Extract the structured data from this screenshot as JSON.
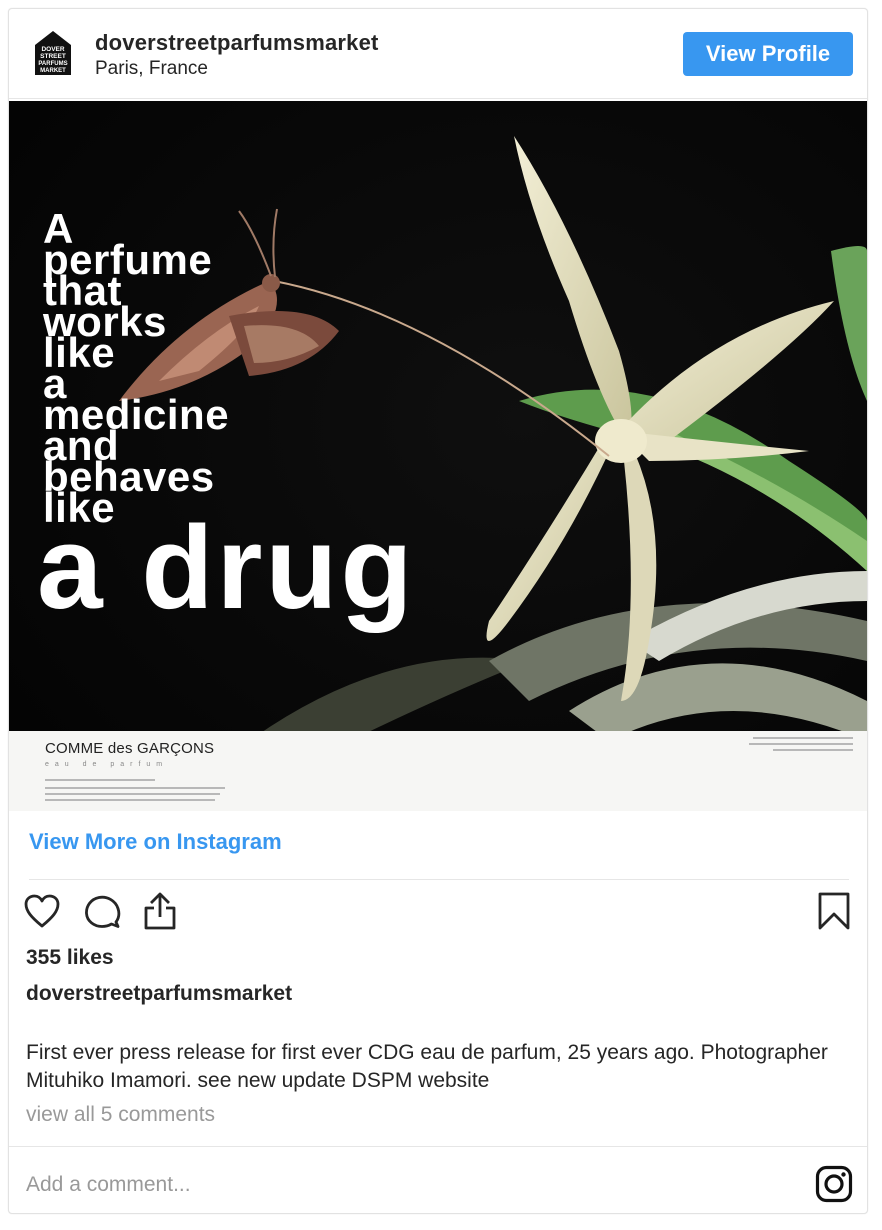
{
  "post": {
    "username": "doverstreetparfumsmarket",
    "location": "Paris, France",
    "view_profile_label": "View Profile",
    "avatar_lines": [
      "DOVER",
      "STREET",
      "PARFUMS",
      "MARKET"
    ]
  },
  "image": {
    "ad_lines": [
      "A",
      "perfume",
      "that",
      "works",
      "like",
      "a",
      "medicine",
      "and",
      "behaves",
      "like"
    ],
    "ad_headline": "a drug",
    "brand": "COMME des GARÇONS",
    "brand_sub": "eau de parfum"
  },
  "view_more_label": "View More on Instagram",
  "actions": {
    "like_icon": "heart-icon",
    "comment_icon": "comment-icon",
    "share_icon": "share-icon",
    "save_icon": "bookmark-icon"
  },
  "likes_text": "355 likes",
  "caption": {
    "username": "doverstreetparfumsmarket",
    "text": "First ever press release for first ever CDG eau de parfum, 25 years ago. Photographer Mituhiko Imamori. see new update DSPM website"
  },
  "comments_link": "view all 5 comments",
  "add_comment_placeholder": "Add a comment...",
  "colors": {
    "accent": "#3897f0",
    "text": "#262626",
    "muted": "#999999"
  }
}
